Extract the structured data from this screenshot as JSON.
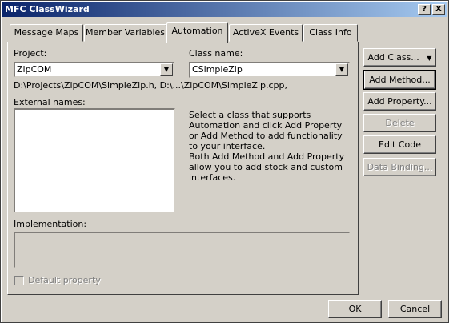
{
  "window": {
    "title": "MFC ClassWizard",
    "help_button": "?",
    "close_button": "X"
  },
  "tabs": [
    {
      "label": "Message Maps",
      "active": false
    },
    {
      "label": "Member Variables",
      "active": false
    },
    {
      "label": "Automation",
      "active": true
    },
    {
      "label": "ActiveX Events",
      "active": false
    },
    {
      "label": "Class Info",
      "active": false
    }
  ],
  "project": {
    "label": "Project:",
    "value": "ZipCOM"
  },
  "class_name": {
    "label": "Class name:",
    "value": "CSimpleZip"
  },
  "file_path": "D:\\Projects\\ZipCOM\\SimpleZip.h, D:\\...\\ZipCOM\\SimpleZip.cpp,",
  "external_names": {
    "label": "External names:"
  },
  "description": {
    "p1": "Select a class that supports Automation and click Add Property or Add Method to add functionality to your interface.",
    "p2": "Both Add Method and Add Property allow you to add stock and custom interfaces."
  },
  "implementation": {
    "label": "Implementation:"
  },
  "default_property": {
    "label": "Default property",
    "checked": false
  },
  "buttons": {
    "add_class": "Add Class...",
    "add_method": "Add Method...",
    "add_property": "Add Property...",
    "delete": "Delete",
    "edit_code": "Edit Code",
    "data_binding": "Data Binding...",
    "ok": "OK",
    "cancel": "Cancel"
  }
}
